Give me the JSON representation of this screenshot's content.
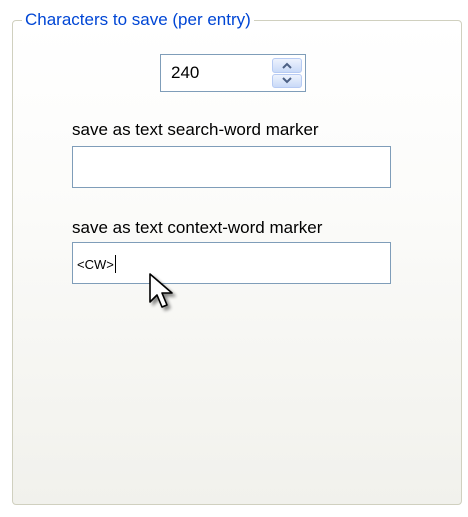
{
  "group": {
    "title": "Characters to save (per entry)"
  },
  "chars_spinner": {
    "value": "240"
  },
  "search_marker": {
    "label": "save as text search-word marker",
    "value": ""
  },
  "context_marker": {
    "label": "save as text context-word marker",
    "value": "<CW>"
  },
  "icons": {
    "spin_up": "chevron-up-icon",
    "spin_down": "chevron-down-icon",
    "cursor": "mouse-pointer-icon"
  },
  "colors": {
    "legend": "#0046d5",
    "field_border": "#7f9db9",
    "group_border": "#d0d0bf"
  }
}
